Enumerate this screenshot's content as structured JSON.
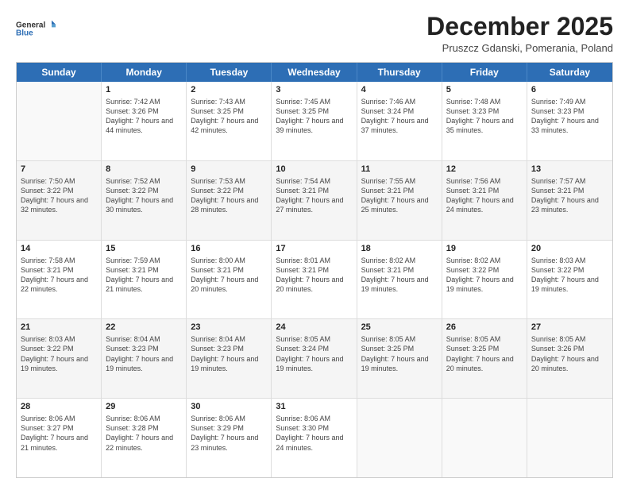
{
  "header": {
    "logo": {
      "line1": "General",
      "line2": "Blue"
    },
    "title": "December 2025",
    "subtitle": "Pruszcz Gdanski, Pomerania, Poland"
  },
  "calendar": {
    "days_of_week": [
      "Sunday",
      "Monday",
      "Tuesday",
      "Wednesday",
      "Thursday",
      "Friday",
      "Saturday"
    ],
    "rows": [
      [
        {
          "day": "",
          "empty": true
        },
        {
          "day": "1",
          "sunrise": "Sunrise: 7:42 AM",
          "sunset": "Sunset: 3:26 PM",
          "daylight": "Daylight: 7 hours and 44 minutes."
        },
        {
          "day": "2",
          "sunrise": "Sunrise: 7:43 AM",
          "sunset": "Sunset: 3:25 PM",
          "daylight": "Daylight: 7 hours and 42 minutes."
        },
        {
          "day": "3",
          "sunrise": "Sunrise: 7:45 AM",
          "sunset": "Sunset: 3:25 PM",
          "daylight": "Daylight: 7 hours and 39 minutes."
        },
        {
          "day": "4",
          "sunrise": "Sunrise: 7:46 AM",
          "sunset": "Sunset: 3:24 PM",
          "daylight": "Daylight: 7 hours and 37 minutes."
        },
        {
          "day": "5",
          "sunrise": "Sunrise: 7:48 AM",
          "sunset": "Sunset: 3:23 PM",
          "daylight": "Daylight: 7 hours and 35 minutes."
        },
        {
          "day": "6",
          "sunrise": "Sunrise: 7:49 AM",
          "sunset": "Sunset: 3:23 PM",
          "daylight": "Daylight: 7 hours and 33 minutes."
        }
      ],
      [
        {
          "day": "7",
          "sunrise": "Sunrise: 7:50 AM",
          "sunset": "Sunset: 3:22 PM",
          "daylight": "Daylight: 7 hours and 32 minutes."
        },
        {
          "day": "8",
          "sunrise": "Sunrise: 7:52 AM",
          "sunset": "Sunset: 3:22 PM",
          "daylight": "Daylight: 7 hours and 30 minutes."
        },
        {
          "day": "9",
          "sunrise": "Sunrise: 7:53 AM",
          "sunset": "Sunset: 3:22 PM",
          "daylight": "Daylight: 7 hours and 28 minutes."
        },
        {
          "day": "10",
          "sunrise": "Sunrise: 7:54 AM",
          "sunset": "Sunset: 3:21 PM",
          "daylight": "Daylight: 7 hours and 27 minutes."
        },
        {
          "day": "11",
          "sunrise": "Sunrise: 7:55 AM",
          "sunset": "Sunset: 3:21 PM",
          "daylight": "Daylight: 7 hours and 25 minutes."
        },
        {
          "day": "12",
          "sunrise": "Sunrise: 7:56 AM",
          "sunset": "Sunset: 3:21 PM",
          "daylight": "Daylight: 7 hours and 24 minutes."
        },
        {
          "day": "13",
          "sunrise": "Sunrise: 7:57 AM",
          "sunset": "Sunset: 3:21 PM",
          "daylight": "Daylight: 7 hours and 23 minutes."
        }
      ],
      [
        {
          "day": "14",
          "sunrise": "Sunrise: 7:58 AM",
          "sunset": "Sunset: 3:21 PM",
          "daylight": "Daylight: 7 hours and 22 minutes."
        },
        {
          "day": "15",
          "sunrise": "Sunrise: 7:59 AM",
          "sunset": "Sunset: 3:21 PM",
          "daylight": "Daylight: 7 hours and 21 minutes."
        },
        {
          "day": "16",
          "sunrise": "Sunrise: 8:00 AM",
          "sunset": "Sunset: 3:21 PM",
          "daylight": "Daylight: 7 hours and 20 minutes."
        },
        {
          "day": "17",
          "sunrise": "Sunrise: 8:01 AM",
          "sunset": "Sunset: 3:21 PM",
          "daylight": "Daylight: 7 hours and 20 minutes."
        },
        {
          "day": "18",
          "sunrise": "Sunrise: 8:02 AM",
          "sunset": "Sunset: 3:21 PM",
          "daylight": "Daylight: 7 hours and 19 minutes."
        },
        {
          "day": "19",
          "sunrise": "Sunrise: 8:02 AM",
          "sunset": "Sunset: 3:22 PM",
          "daylight": "Daylight: 7 hours and 19 minutes."
        },
        {
          "day": "20",
          "sunrise": "Sunrise: 8:03 AM",
          "sunset": "Sunset: 3:22 PM",
          "daylight": "Daylight: 7 hours and 19 minutes."
        }
      ],
      [
        {
          "day": "21",
          "sunrise": "Sunrise: 8:03 AM",
          "sunset": "Sunset: 3:22 PM",
          "daylight": "Daylight: 7 hours and 19 minutes."
        },
        {
          "day": "22",
          "sunrise": "Sunrise: 8:04 AM",
          "sunset": "Sunset: 3:23 PM",
          "daylight": "Daylight: 7 hours and 19 minutes."
        },
        {
          "day": "23",
          "sunrise": "Sunrise: 8:04 AM",
          "sunset": "Sunset: 3:23 PM",
          "daylight": "Daylight: 7 hours and 19 minutes."
        },
        {
          "day": "24",
          "sunrise": "Sunrise: 8:05 AM",
          "sunset": "Sunset: 3:24 PM",
          "daylight": "Daylight: 7 hours and 19 minutes."
        },
        {
          "day": "25",
          "sunrise": "Sunrise: 8:05 AM",
          "sunset": "Sunset: 3:25 PM",
          "daylight": "Daylight: 7 hours and 19 minutes."
        },
        {
          "day": "26",
          "sunrise": "Sunrise: 8:05 AM",
          "sunset": "Sunset: 3:25 PM",
          "daylight": "Daylight: 7 hours and 20 minutes."
        },
        {
          "day": "27",
          "sunrise": "Sunrise: 8:05 AM",
          "sunset": "Sunset: 3:26 PM",
          "daylight": "Daylight: 7 hours and 20 minutes."
        }
      ],
      [
        {
          "day": "28",
          "sunrise": "Sunrise: 8:06 AM",
          "sunset": "Sunset: 3:27 PM",
          "daylight": "Daylight: 7 hours and 21 minutes."
        },
        {
          "day": "29",
          "sunrise": "Sunrise: 8:06 AM",
          "sunset": "Sunset: 3:28 PM",
          "daylight": "Daylight: 7 hours and 22 minutes."
        },
        {
          "day": "30",
          "sunrise": "Sunrise: 8:06 AM",
          "sunset": "Sunset: 3:29 PM",
          "daylight": "Daylight: 7 hours and 23 minutes."
        },
        {
          "day": "31",
          "sunrise": "Sunrise: 8:06 AM",
          "sunset": "Sunset: 3:30 PM",
          "daylight": "Daylight: 7 hours and 24 minutes."
        },
        {
          "day": "",
          "empty": true
        },
        {
          "day": "",
          "empty": true
        },
        {
          "day": "",
          "empty": true
        }
      ]
    ]
  }
}
